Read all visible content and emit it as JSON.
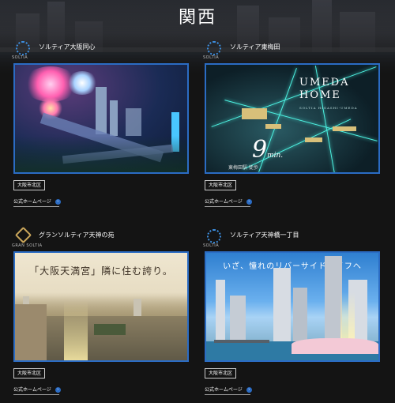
{
  "region": {
    "title": "関西"
  },
  "properties": [
    {
      "logo_text": "SOLTIA",
      "name": "ソルティア大阪同心",
      "area_badge": "大阪市北区",
      "link_label": "公式ホームページ"
    },
    {
      "logo_text": "SOLTIA",
      "name": "ソルティア東梅田",
      "area_badge": "大阪市北区",
      "link_label": "公式ホームページ",
      "photo": {
        "heading": "UMEDA",
        "heading2": "HOME",
        "subheading": "SOLTIA HIGASHI-UMEDA",
        "minutes": "9",
        "minutes_unit": "min.",
        "note": "東梅田駅 徒歩"
      }
    },
    {
      "logo_text": "GRAN SOLTIA",
      "name": "グランソルティア天神の苑",
      "area_badge": "大阪市北区",
      "link_label": "公式ホームページ",
      "photo": {
        "catch": "「大阪天満宮」隣に住む誇り。"
      }
    },
    {
      "logo_text": "SOLTIA",
      "name": "ソルティア天神橋一丁目",
      "area_badge": "大阪市北区",
      "link_label": "公式ホームページ",
      "photo": {
        "catch": "いざ、憧れのリバーサイドライフへ"
      }
    }
  ],
  "colors": {
    "accent": "#2b6cc4",
    "background": "#141414",
    "gold": "#c9a55a"
  },
  "icons": {
    "link_arrow": "arrow-right-circle-icon",
    "logo": "soltia-logo-icon"
  }
}
